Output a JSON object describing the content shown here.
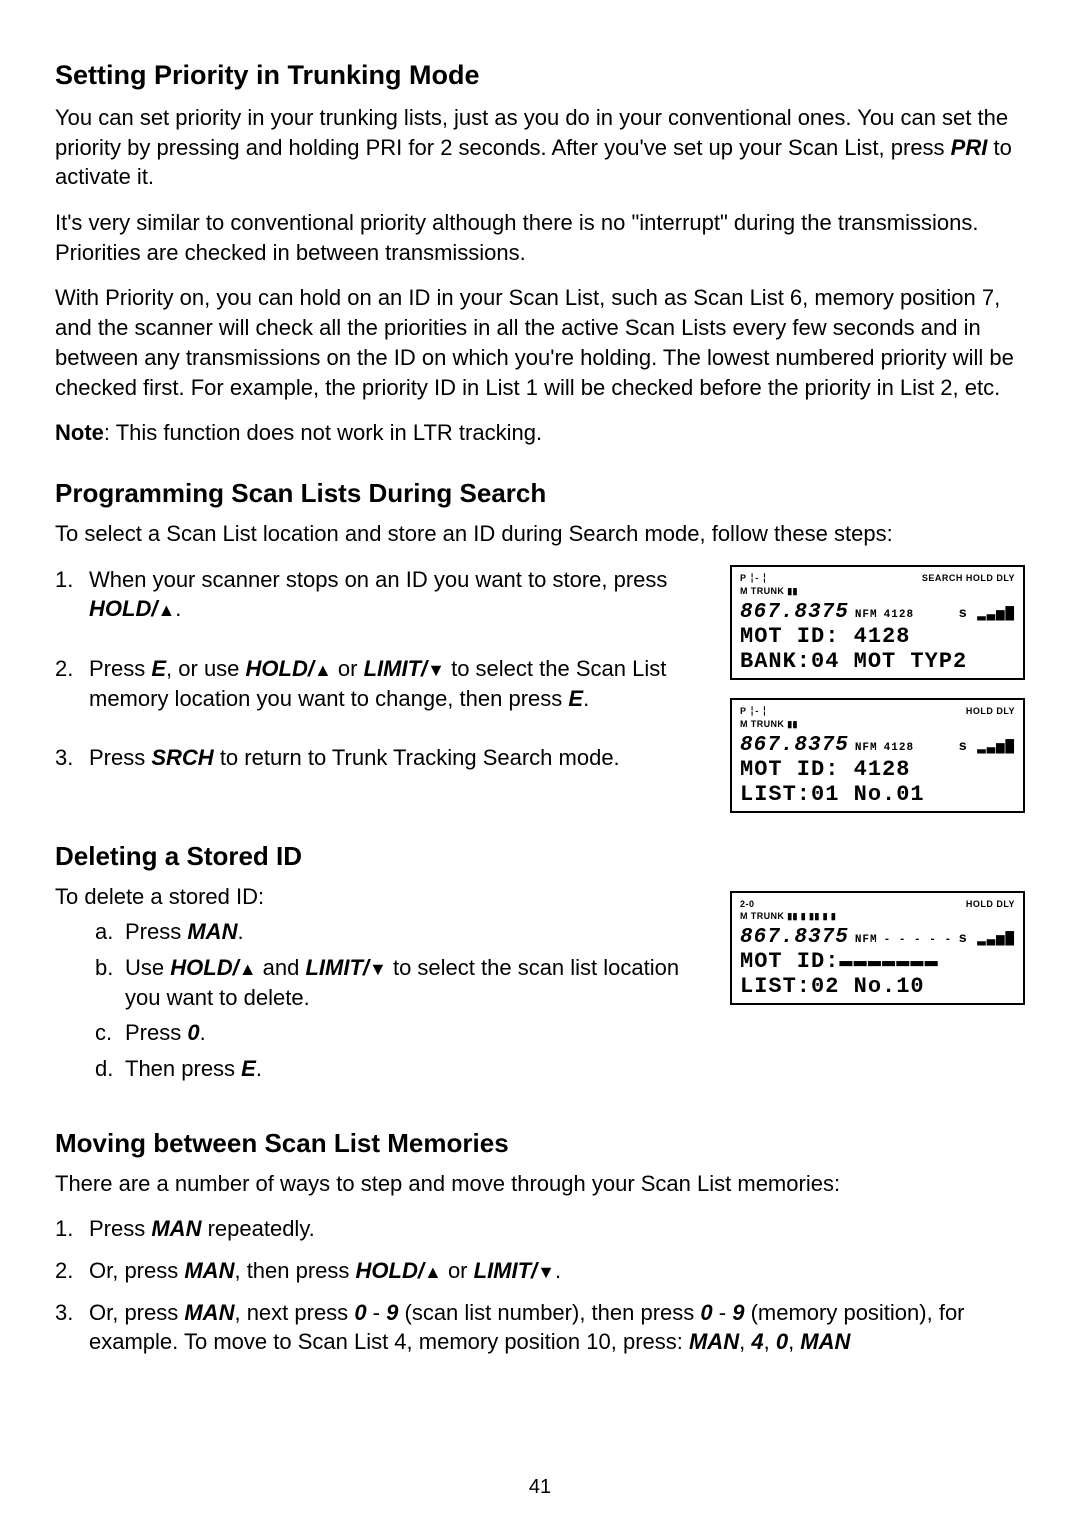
{
  "page_number": "41",
  "s1": {
    "title": "Setting Priority in Trunking Mode",
    "p1a": "You can set priority in your trunking lists, just as you do in your conventional ones. You can set the priority by pressing and holding PRI for 2 seconds. After you've set up your Scan List, press ",
    "p1b": " to activate it.",
    "pri": "PRI",
    "p2": "It's very similar to conventional priority although there is no \"interrupt\" during the transmissions. Priorities are checked in between transmissions.",
    "p3": "With Priority on, you can hold on an ID in your Scan List, such as Scan List 6, memory position 7, and the scanner will check all the priorities in all the active Scan Lists every few seconds and in between any transmissions on the ID on which you're holding. The lowest numbered priority will be checked first. For example, the priority ID in List 1 will be checked before the priority in List 2, etc.",
    "noteLabel": "Note",
    "noteText": ": This function does not work in LTR tracking."
  },
  "s2": {
    "title": "Programming Scan Lists During Search",
    "intro": "To select a Scan List location and store an ID during Search mode, follow these steps:",
    "st1a": "When your scanner stops on an ID you want to store, press ",
    "st1b": "HOLD/",
    "st1c": ".",
    "st2a": "Press ",
    "st2b": ", or use ",
    "st2c": " or ",
    "st2d": " to select the Scan List memory location you want to change, then press ",
    "st2e": ".",
    "st3a": "Press ",
    "st3b": " to return to Trunk Tracking Search mode.",
    "key_E": "E",
    "key_HOLD": "HOLD/",
    "key_LIMIT": "LIMIT/",
    "key_SRCH": "SRCH"
  },
  "s3": {
    "title": "Deleting a Stored ID",
    "intro": "To delete a stored ID:",
    "a1": "Press ",
    "a1k": "MAN",
    "a1end": ".",
    "b1": "Use ",
    "b2": " and ",
    "b3": " to select the scan list location you want to delete.",
    "c1": "Press ",
    "c1k": "0",
    "c1end": ".",
    "d1": "Then press ",
    "d1k": "E",
    "d1end": "."
  },
  "s4": {
    "title": "Moving between Scan List Memories",
    "intro": "There are a number of ways to step and move through your Scan List memories:",
    "m1a": "Press ",
    "m1b": " repeatedly.",
    "m2a": "Or, press ",
    "m2b": ", then press ",
    "m2c": " or ",
    "m2d": ".",
    "m3a": "Or, press ",
    "m3b": ", next press ",
    "m3c": " - ",
    "m3d": " (scan list number), then press ",
    "m3e": " (memory position), for example. To move to Scan List 4, memory position 10, press: ",
    "key_MAN": "MAN",
    "key_0": "0",
    "key_9": "9",
    "key_4": "4",
    "seq_sep": ", "
  },
  "lcd1": {
    "topL": "P  ╎- ╎",
    "topR": "SEARCH  HOLD   DLY",
    "sub": "M  TRUNK ▮▮",
    "freq": "867.8375",
    "mode": "NFM",
    "ch": "4128",
    "sig": "s ▂▃▅▇",
    "l1": "MOT ID:  4128",
    "l2": "BANK:04 MOT TYP2"
  },
  "lcd2": {
    "topL": "P  ╎- ╎",
    "topR": "HOLD   DLY",
    "sub": "M  TRUNK ▮▮",
    "freq": "867.8375",
    "mode": "NFM",
    "ch": "4128",
    "sig": "s ▂▃▅▇",
    "l1": "MOT ID:  4128",
    "l2": "LIST:01 No.01"
  },
  "lcd3": {
    "topL": "2-0",
    "topR": "HOLD   DLY",
    "sub": "M  TRUNK ▮▮ ▮ ▮▮ ▮ ▮",
    "freq": "867.8375",
    "mode": "NFM",
    "ch": "- - - - -",
    "sig": "s ▂▃▅▇",
    "l1": "MOT ID:▬▬▬▬▬▬▬",
    "l2": "LIST:02 No.10"
  }
}
